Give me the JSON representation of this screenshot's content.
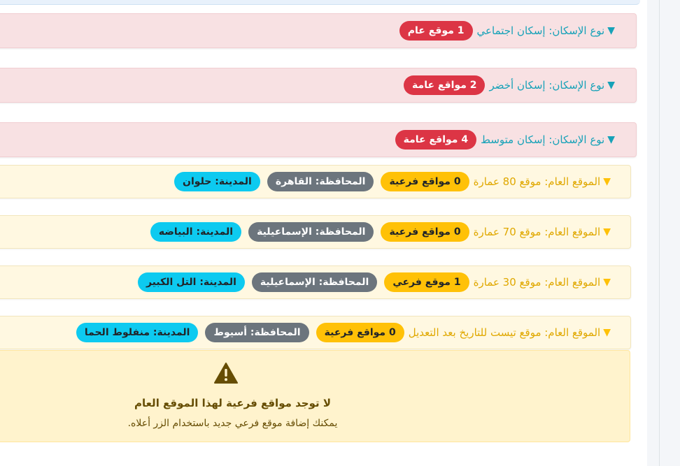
{
  "housing_types": [
    {
      "toggle": "▼",
      "label": "نوع الإسكان: إسكان اجتماعي",
      "badge": "1 موقع عام"
    },
    {
      "toggle": "▼",
      "label": "نوع الإسكان: إسكان أخضر",
      "badge": "2 مواقع عامة"
    },
    {
      "toggle": "▼",
      "label": "نوع الإسكان: إسكان متوسط",
      "badge": "4 مواقع عامة"
    }
  ],
  "sites": [
    {
      "toggle": "▼",
      "label": "الموقع العام: موقع 80 عمارة",
      "count": "0 مواقع فرعية",
      "governorate": "المحافظة: القاهرة",
      "city": "المدينة: حلوان"
    },
    {
      "toggle": "▼",
      "label": "الموقع العام: موقع 70 عمارة",
      "count": "0 مواقع فرعية",
      "governorate": "المحافظة: الإسماعيلية",
      "city": "المدينة: البياضه"
    },
    {
      "toggle": "▼",
      "label": "الموقع العام: موقع 30 عمارة",
      "count": "1 موقع فرعي",
      "governorate": "المحافظة: الإسماعيلية",
      "city": "المدينة: التل الكبير"
    },
    {
      "toggle": "▼",
      "label": "الموقع العام: موقع تيست للتاريخ بعد التعديل",
      "count": "0 مواقع فرعية",
      "governorate": "المحافظة: أسيوط",
      "city": "المدينة: منفلوط الحما"
    }
  ],
  "empty_state": {
    "icon": "warning-triangle-icon",
    "title": "لا توجد مواقع فرعية لهذا الموقع العام",
    "text": "يمكنك إضافة موقع فرعي جديد باستخدام الزر أعلاه."
  },
  "colors": {
    "housing_accent": "#17a2b8",
    "site_accent": "#e0a800",
    "badge_red": "#dc3545",
    "badge_yellow": "#ffc107",
    "badge_gray": "#6c757d",
    "badge_cyan": "#0dcaf0"
  }
}
